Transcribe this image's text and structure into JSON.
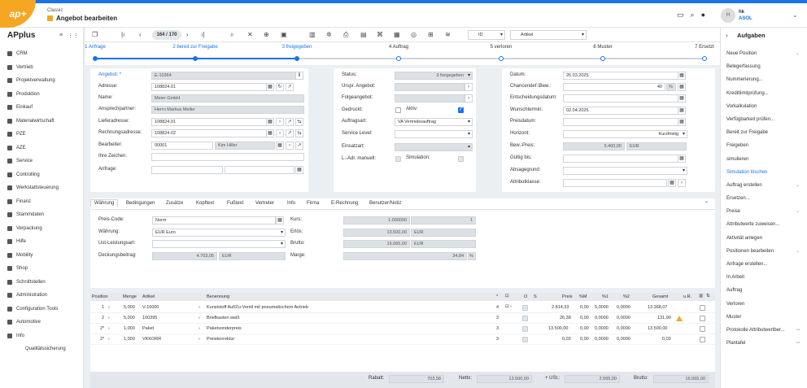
{
  "app": {
    "module": "Classic",
    "title": "Angebot bearbeiten",
    "name": "APplus",
    "logo": "ap+"
  },
  "user": {
    "initial": "H",
    "name": "hk",
    "company": "ASOL"
  },
  "toolbar": {
    "pager": "164 / 170",
    "id_select": "ID",
    "view_select": "Artikel"
  },
  "nav": [
    "CRM",
    "Vertrieb",
    "Projektverwaltung",
    "Produktion",
    "Einkauf",
    "Materialwirtschaft",
    "PZE",
    "AZE",
    "Service",
    "Controlling",
    "Werkstattsteuerung",
    "Finanz",
    "Stammdaten",
    "Verpackung",
    "Hilfe",
    "Mobility",
    "Shop",
    "Schnittstellen",
    "Administration",
    "Configuration Tools",
    "Automotive",
    "Info"
  ],
  "nav_sub": "Qualitätssicherung",
  "steps": [
    "1 Anfrage",
    "2 bereit zur Freigabe",
    "3 freigegeben",
    "4 Auftrag",
    "5 verloren",
    "6 Muster",
    "7 Ersetzt"
  ],
  "left_form": {
    "angebot_label": "Angebot: *",
    "angebot": "E-10364",
    "adresse_label": "Adresse:",
    "adresse": "108824.01",
    "name_label": "Name:",
    "name": "Meier GmbH",
    "ansprech_label": "Ansprechpartner:",
    "ansprech": "Herrn Markus Meller",
    "liefer_label": "Lieferadresse:",
    "liefer": "108824.01",
    "rechnung_label": "Rechnungsadresse:",
    "rechnung": "108824.02",
    "bearbeiter_label": "Bearbeiter:",
    "bearbeiter": "00001",
    "bearbeiter_name": "Kim Hiller",
    "zeichen_label": "Ihre Zeichen:",
    "anfrage_label": "Anfrage:"
  },
  "mid_form": {
    "status_label": "Status:",
    "status": "3 freigegeben",
    "urspr_label": "Urspr. Angebot:",
    "folge_label": "Folgeangebot:",
    "gedruckt_label": "Gedruckt:",
    "aktiv_label": "Aktiv:",
    "auftragsart_label": "Auftragsart:",
    "auftragsart": "VA Vertriebsauftrag",
    "service_label": "Service Level:",
    "einsatz_label": "Einsatzart:",
    "ladr_label": "L.-Adr. manuell:",
    "sim_label": "Simulation:"
  },
  "right_form": {
    "datum_label": "Datum:",
    "datum": "26.03.2025",
    "chance_label": "Chancendef.\\Bew.:",
    "chance": "40",
    "chance_unit": "%",
    "entsch_label": "Entscheidungsdatum:",
    "wunsch_label": "Wunschtermin:",
    "wunsch": "02.04.2025",
    "preisdatum_label": "Preisdatum:",
    "horizont_label": "Horizont:",
    "horizont": "Kurzfristig",
    "bewpreis_label": "Bew.-Preis:",
    "bewpreis": "5.400,00",
    "bewpreis_cur": "EUR",
    "gueltig_label": "Gültig bis:",
    "absage_label": "Absagegrund:",
    "attr_label": "Attributklasse:"
  },
  "tabs": [
    "Währung",
    "Bedingungen",
    "Zusätze",
    "Kopftext",
    "Fußtext",
    "Vertreter",
    "Info",
    "Firma",
    "E-Rechnung",
    "Benutzer/Notiz"
  ],
  "waehrung": {
    "preiscode_label": "Preis-Code:",
    "preiscode": "Norm",
    "waehrung_label": "Währung:",
    "waehrung": "EUR Euro",
    "ust_label": "Ust-Leistungsart:",
    "deckung_label": "Deckungsbeitrag:",
    "deckung": "4.703,05",
    "deckung_cur": "EUR",
    "kurs_label": "Kurs:",
    "kurs": "1.000000",
    "kurs2": "1",
    "erloes_label": "Erlös:",
    "erloes": "13.500,00",
    "erloes_cur": "EUR",
    "brutto_label": "Brutto:",
    "brutto": "16.065,00",
    "brutto_cur": "EUR",
    "marge_label": "Marge:",
    "marge": "34,84",
    "marge_unit": "%"
  },
  "grid": {
    "headers": {
      "pos": "Position",
      "menge": "Menge",
      "artikel": "Artikel",
      "benennung": "Benennung",
      "star": "*",
      "o": "O",
      "s": "S",
      "preis": "Preis",
      "pm": "%M",
      "p1": "%1",
      "p2": "%2",
      "gesamt": "Gesamt",
      "ur": "u.R."
    },
    "rows": [
      {
        "pos": "1",
        "menge": "5,000",
        "artikel": "V-10000",
        "benennung": "Kunststoff Auf/Zu-Ventil mit pneumatischem Antrieb",
        "star": "4",
        "preis": "2.814,33",
        "pm": "0,00",
        "p1": "5,0000",
        "p2": "0,0000",
        "gesamt": "13.368,07"
      },
      {
        "pos": "2",
        "menge": "5,000",
        "artikel": "100395",
        "benennung": "Briefkasten weiß",
        "star": "3",
        "preis": "26,38",
        "pm": "0,00",
        "p1": "0,0000",
        "p2": "0,0000",
        "gesamt": "131,90"
      },
      {
        "pos": "2*",
        "menge": "1,000",
        "artikel": "Paket",
        "benennung": "Paketsonderpreis",
        "star": "3",
        "preis": "13.500,00",
        "pm": "0,00",
        "p1": "0,0000",
        "p2": "0,0000",
        "gesamt": "13.500,00"
      },
      {
        "pos": "2*",
        "menge": "1,000",
        "artikel": "VKKORR",
        "benennung": "Preiskorrektur",
        "star": "3",
        "preis": "0,03",
        "pm": "0,00",
        "p1": "0,0000",
        "p2": "0,0000",
        "gesamt": "0,03"
      }
    ]
  },
  "totals": {
    "rabatt_label": "Rabatt:",
    "rabatt": "703,58",
    "netto_label": "Netto:",
    "netto": "13.500,00",
    "ust_label": "+ USt.:",
    "ust": "2.565,00",
    "brutto_label": "Brutto:",
    "brutto": "16.065,00"
  },
  "aside": {
    "title": "Aufgaben",
    "items": [
      {
        "label": "Neue Position",
        "chev": true
      },
      {
        "label": "Belegerfassung"
      },
      {
        "label": "Nummerierung..."
      },
      {
        "label": "Kreditlimitprüfung..."
      },
      {
        "label": "Vorkalkulation"
      },
      {
        "label": "Verfügbarkeit prüfen..."
      },
      {
        "label": "Bereit zur Freigabe"
      },
      {
        "label": "Freigeben"
      },
      {
        "label": "simulieren"
      },
      {
        "label": "Simulation löschen",
        "blue": true
      },
      {
        "label": "Auftrag erstellen",
        "chev": true
      },
      {
        "label": "Ersetzen..."
      },
      {
        "label": "Preise",
        "chev": true
      },
      {
        "label": "Attributwerte zuweisen..."
      },
      {
        "label": "Aktivität anlegen"
      },
      {
        "label": "Positionen bearbeiten",
        "chev": true
      },
      {
        "label": "Anfrage erstellen..."
      },
      {
        "label": "In Arbeit"
      },
      {
        "label": "Auftrag"
      },
      {
        "label": "Verloren"
      },
      {
        "label": "Muster"
      },
      {
        "label": "Protokolle Attributwertber...",
        "link": true
      },
      {
        "label": "Plantafel",
        "link": true
      }
    ]
  }
}
